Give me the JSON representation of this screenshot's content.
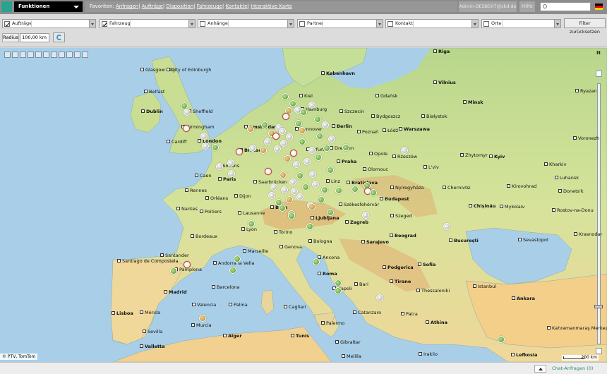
{
  "topbar": {
    "menu_label": "Funktionen",
    "favorites_label": "Favoriten:",
    "favorites": [
      "Anfragen",
      "Aufträge",
      "Disposition",
      "Fahrzeuge",
      "Kontakte",
      "Interaktive Karte"
    ],
    "user": "Admin-DESB507@skd.de",
    "help_label": "Hilfe",
    "search_placeholder": "",
    "colors": {
      "teal": "#2aa38e",
      "bar": "#8c8c8c"
    }
  },
  "filters": [
    {
      "label": "Aufträge",
      "checked": true,
      "value": ""
    },
    {
      "label": "Fahrzeuge",
      "checked": true,
      "value": ""
    },
    {
      "label": "Anhänger",
      "checked": false,
      "value": ""
    },
    {
      "label": "Partner",
      "checked": false,
      "value": ""
    },
    {
      "label": "Kontakte",
      "checked": false,
      "value": ""
    },
    {
      "label": "Orte",
      "checked": false,
      "value": ""
    }
  ],
  "reset_label": "Filter zurücksetzen",
  "radius": {
    "label": "Radius",
    "value": "100,00 km"
  },
  "map": {
    "copyright": "© PTV, TomTom",
    "scale": "200 km",
    "north": "N",
    "tool_icons": [
      "pan-icon",
      "zoom-icon",
      "measure-icon",
      "layers-icon",
      "print-icon",
      "globe-icon",
      "grid-icon",
      "fullscreen-icon",
      "back-icon",
      "forward-icon",
      "home-icon"
    ],
    "cities": [
      {
        "name": "Riga",
        "cap": true
      },
      {
        "name": "Glasgow City",
        "cap": false
      },
      {
        "name": "City of Edinburgh",
        "cap": false
      },
      {
        "name": "København",
        "cap": true
      },
      {
        "name": "Vilnius",
        "cap": true
      },
      {
        "name": "Ryazan",
        "cap": false
      },
      {
        "name": "Belfast",
        "cap": false
      },
      {
        "name": "Kiel",
        "cap": false
      },
      {
        "name": "Gdańsk",
        "cap": false
      },
      {
        "name": "Minsk",
        "cap": true
      },
      {
        "name": "Dublin",
        "cap": true
      },
      {
        "name": "Sheffield",
        "cap": false
      },
      {
        "name": "Hamburg",
        "cap": false
      },
      {
        "name": "Szczecin",
        "cap": false
      },
      {
        "name": "Bydgoszcz",
        "cap": false
      },
      {
        "name": "Białystok",
        "cap": false
      },
      {
        "name": "Birmingham",
        "cap": false
      },
      {
        "name": "Amsterdam",
        "cap": true
      },
      {
        "name": "Hannover",
        "cap": false
      },
      {
        "name": "Berlin",
        "cap": true
      },
      {
        "name": "Poznań",
        "cap": false
      },
      {
        "name": "Łódź",
        "cap": false
      },
      {
        "name": "Warszawa",
        "cap": true
      },
      {
        "name": "Voronezh",
        "cap": false
      },
      {
        "name": "Cardiff",
        "cap": false
      },
      {
        "name": "London",
        "cap": true
      },
      {
        "name": "Brussel",
        "cap": true
      },
      {
        "name": "Dresden",
        "cap": false
      },
      {
        "name": "Erfurt",
        "cap": false
      },
      {
        "name": "Opole",
        "cap": false
      },
      {
        "name": "Rzeszów",
        "cap": false
      },
      {
        "name": "Zhytomyr",
        "cap": false
      },
      {
        "name": "Kyiv",
        "cap": true
      },
      {
        "name": "Amiens",
        "cap": false
      },
      {
        "name": "Praha",
        "cap": true
      },
      {
        "name": "Olomouc",
        "cap": false
      },
      {
        "name": "L'viv",
        "cap": false
      },
      {
        "name": "Kharkiv",
        "cap": false
      },
      {
        "name": "Caen",
        "cap": false
      },
      {
        "name": "Paris",
        "cap": true
      },
      {
        "name": "Saarbrücken",
        "cap": false
      },
      {
        "name": "Linz",
        "cap": false
      },
      {
        "name": "Bratislava",
        "cap": true
      },
      {
        "name": "Luhansk",
        "cap": false
      },
      {
        "name": "Rennes",
        "cap": false
      },
      {
        "name": "Orléans",
        "cap": false
      },
      {
        "name": "Dijon",
        "cap": false
      },
      {
        "name": "Nyíregyháza",
        "cap": false
      },
      {
        "name": "Chernivtsi",
        "cap": false
      },
      {
        "name": "Kirovohrad",
        "cap": false
      },
      {
        "name": "Donets'k",
        "cap": false
      },
      {
        "name": "Nantes",
        "cap": false
      },
      {
        "name": "Poitiers",
        "cap": false
      },
      {
        "name": "Bern",
        "cap": true
      },
      {
        "name": "Székesfehérvár",
        "cap": false
      },
      {
        "name": "Budapest",
        "cap": true
      },
      {
        "name": "Chișinău",
        "cap": true
      },
      {
        "name": "Mykolaiv",
        "cap": false
      },
      {
        "name": "Rostov-na-Donu",
        "cap": false
      },
      {
        "name": "Lausanne",
        "cap": false
      },
      {
        "name": "Ljubljana",
        "cap": true
      },
      {
        "name": "Zagreb",
        "cap": true
      },
      {
        "name": "Szeged",
        "cap": false
      },
      {
        "name": "Lyon",
        "cap": false
      },
      {
        "name": "Torino",
        "cap": false
      },
      {
        "name": "Beograd",
        "cap": true
      },
      {
        "name": "Bordeaux",
        "cap": false
      },
      {
        "name": "Bologna",
        "cap": false
      },
      {
        "name": "Sarajevo",
        "cap": true
      },
      {
        "name": "București",
        "cap": true
      },
      {
        "name": "Sevastopol",
        "cap": false
      },
      {
        "name": "Krasnodar",
        "cap": false
      },
      {
        "name": "Genova",
        "cap": false
      },
      {
        "name": "Marseille",
        "cap": false
      },
      {
        "name": "Santander",
        "cap": false
      },
      {
        "name": "Andorra la Vella",
        "cap": false
      },
      {
        "name": "Ancona",
        "cap": false
      },
      {
        "name": "Sofia",
        "cap": true
      },
      {
        "name": "Santiago de Compostela",
        "cap": false
      },
      {
        "name": "Pamplona",
        "cap": false
      },
      {
        "name": "Podgorica",
        "cap": true
      },
      {
        "name": "Roma",
        "cap": true
      },
      {
        "name": "Tirane",
        "cap": true
      },
      {
        "name": "Barcelona",
        "cap": false
      },
      {
        "name": "Bari",
        "cap": false
      },
      {
        "name": "Istanbul",
        "cap": false
      },
      {
        "name": "Napoli",
        "cap": false
      },
      {
        "name": "Madrid",
        "cap": true
      },
      {
        "name": "Thessaloniki",
        "cap": false
      },
      {
        "name": "Ankara",
        "cap": true
      },
      {
        "name": "Valencia",
        "cap": false
      },
      {
        "name": "Palma",
        "cap": false
      },
      {
        "name": "Cagliari",
        "cap": false
      },
      {
        "name": "Lisboa",
        "cap": true
      },
      {
        "name": "Mérida",
        "cap": false
      },
      {
        "name": "Catanzaro",
        "cap": false
      },
      {
        "name": "Patra",
        "cap": false
      },
      {
        "name": "Palermo",
        "cap": false
      },
      {
        "name": "Athina",
        "cap": true
      },
      {
        "name": "Kahramanmaraş Merkez",
        "cap": false
      },
      {
        "name": "Sevilla",
        "cap": false
      },
      {
        "name": "Murcia",
        "cap": false
      },
      {
        "name": "Alger",
        "cap": true
      },
      {
        "name": "Tunis",
        "cap": true
      },
      {
        "name": "Gibraltar",
        "cap": false
      },
      {
        "name": "Valletta",
        "cap": true
      },
      {
        "name": "Melilla",
        "cap": false
      },
      {
        "name": "Iraklio",
        "cap": false
      },
      {
        "name": "Lefkosia",
        "cap": true
      }
    ]
  },
  "status": {
    "chat_label": "Chat-Anfragen (0)"
  }
}
